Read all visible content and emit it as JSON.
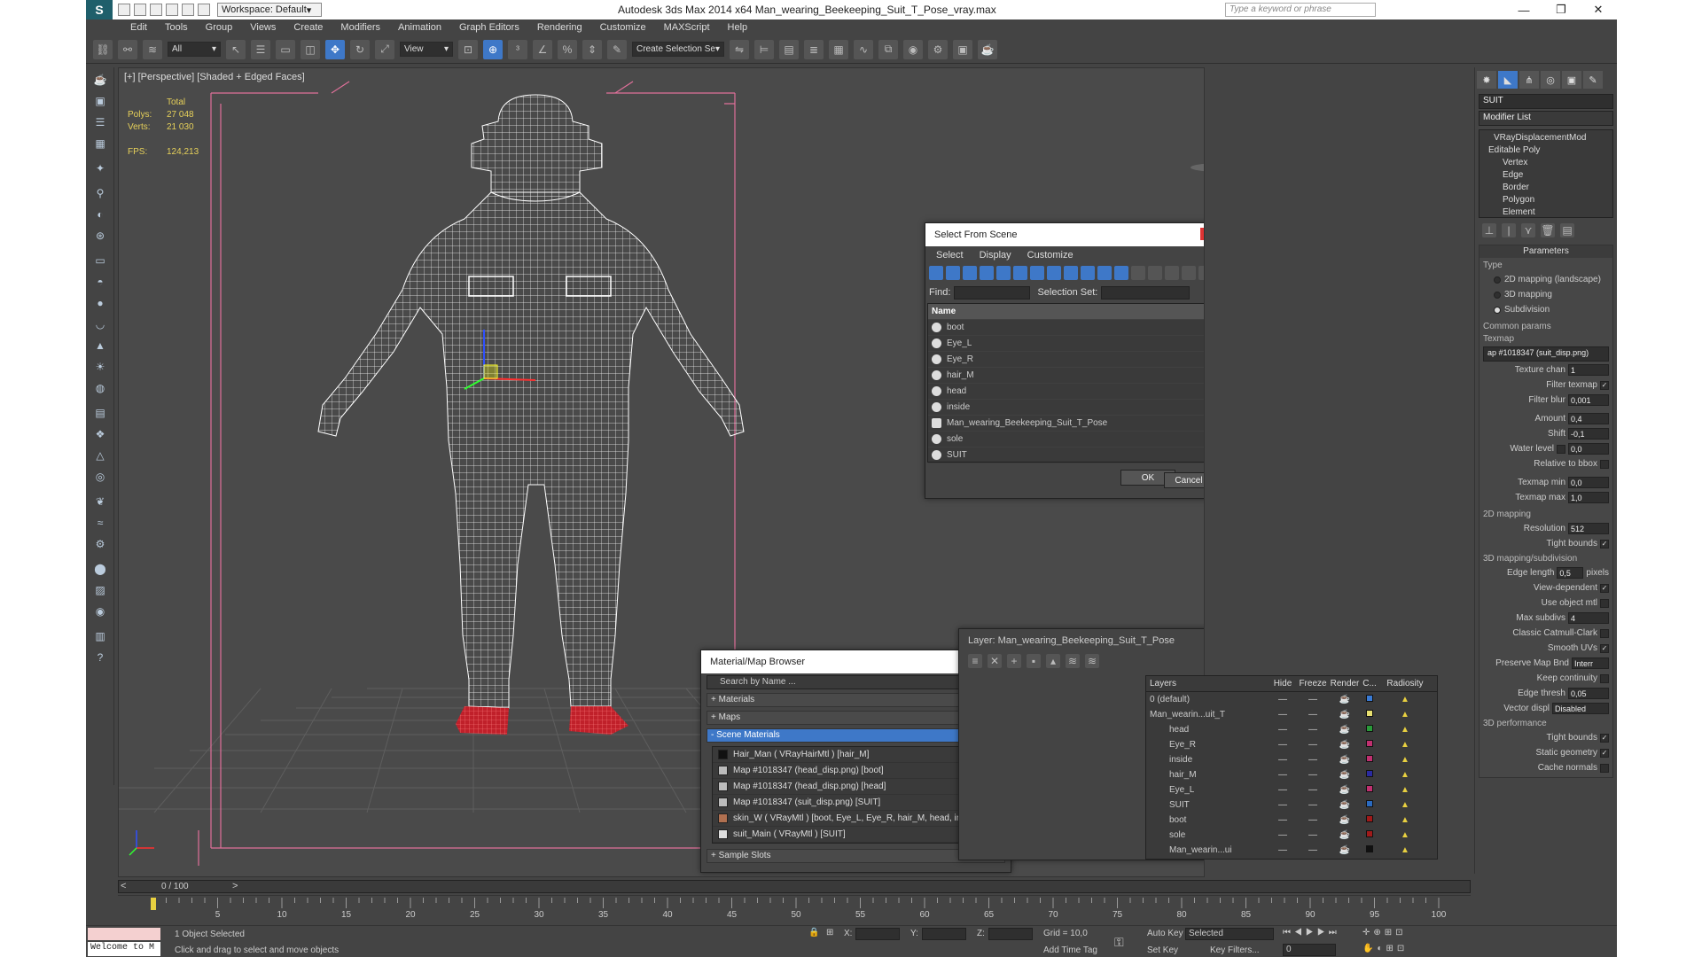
{
  "app": {
    "title": "Autodesk 3ds Max  2014 x64    Man_wearing_Beekeeping_Suit_T_Pose_vray.max",
    "workspace": "Workspace: Default",
    "search_placeholder": "Type a keyword or phrase"
  },
  "menu": [
    "Edit",
    "Tools",
    "Group",
    "Views",
    "Create",
    "Modifiers",
    "Animation",
    "Graph Editors",
    "Rendering",
    "Customize",
    "MAXScript",
    "Help"
  ],
  "toolbar": {
    "filter": "All",
    "ref_coord": "View",
    "selection_set": "Create Selection Se"
  },
  "viewport": {
    "label": "[+] [Perspective] [Shaded + Edged Faces]",
    "stats": {
      "total_label": "Total",
      "polys_label": "Polys:",
      "polys_value": "27 048",
      "verts_label": "Verts:",
      "verts_value": "21 030",
      "fps_label": "FPS:",
      "fps_value": "124,213"
    }
  },
  "command_panel": {
    "object_name": "SUIT",
    "modifier_list": "Modifier List",
    "stack": [
      "VRayDisplacementMod",
      "Editable Poly",
      "Vertex",
      "Edge",
      "Border",
      "Polygon",
      "Element"
    ],
    "parameters_title": "Parameters",
    "type_label": "Type",
    "type_options": [
      "2D mapping (landscape)",
      "3D mapping",
      "Subdivision"
    ],
    "common_params": "Common params",
    "texmap_label": "Texmap",
    "texmap_value": "ap #1018347 (suit_disp.png)",
    "texture_chan_label": "Texture chan",
    "texture_chan_value": "1",
    "filter_texmap_label": "Filter texmap",
    "filter_blur_label": "Filter blur",
    "filter_blur_value": "0,001",
    "amount_label": "Amount",
    "amount_value": "0,4",
    "shift_label": "Shift",
    "shift_value": "-0,1",
    "water_level_label": "Water level",
    "water_level_value": "0,0",
    "relative_bbox_label": "Relative to bbox",
    "texmap_min_label": "Texmap min",
    "texmap_min_value": "0,0",
    "texmap_max_label": "Texmap max",
    "texmap_max_value": "1,0",
    "mapping2d_title": "2D mapping",
    "resolution_label": "Resolution",
    "resolution_value": "512",
    "tight_bounds_label": "Tight bounds",
    "mapping3d_title": "3D mapping/subdivision",
    "edge_length_label": "Edge length",
    "edge_length_value": "0,5",
    "pixels_label": "pixels",
    "view_dependent_label": "View-dependent",
    "use_object_mtl_label": "Use object mtl",
    "max_subdivs_label": "Max subdivs",
    "max_subdivs_value": "4",
    "classic_catmull_label": "Classic Catmull-Clark",
    "smooth_uvs_label": "Smooth UVs",
    "preserve_map_label": "Preserve Map Bnd",
    "preserve_map_value": "Interr",
    "keep_continuity_label": "Keep continuity",
    "edge_thresh_label": "Edge thresh",
    "edge_thresh_value": "0,05",
    "vector_displ_label": "Vector displ",
    "vector_displ_value": "Disabled",
    "perf_title": "3D performance",
    "perf_tight_bounds_label": "Tight bounds",
    "static_geometry_label": "Static geometry",
    "cache_normals_label": "Cache normals"
  },
  "select_dialog": {
    "title": "Select From Scene",
    "menu": [
      "Select",
      "Display",
      "Customize"
    ],
    "find_label": "Find:",
    "selection_set_label": "Selection Set:",
    "column_name": "Name",
    "items": [
      "boot",
      "Eye_L",
      "Eye_R",
      "hair_M",
      "head",
      "inside",
      "Man_wearing_Beekeeping_Suit_T_Pose",
      "sole",
      "SUIT"
    ],
    "ok": "OK",
    "cancel": "Cancel"
  },
  "material_browser": {
    "title": "Material/Map Browser",
    "search_placeholder": "Search by Name ...",
    "sections": [
      "+ Materials",
      "+ Maps",
      "- Scene Materials"
    ],
    "scene_materials": [
      {
        "name": "Hair_Man  ( VRayHairMtl ) [hair_M]",
        "color": "#111111"
      },
      {
        "name": "Map #1018347 (head_disp.png) [boot]",
        "color": "#bbbbbb"
      },
      {
        "name": "Map #1018347 (head_disp.png) [head]",
        "color": "#bbbbbb"
      },
      {
        "name": "Map #1018347 (suit_disp.png) [SUIT]",
        "color": "#bbbbbb"
      },
      {
        "name": "skin_W  ( VRayMtl ) [boot, Eye_L, Eye_R, hair_M, head, inside,...",
        "color": "#b07050"
      },
      {
        "name": "suit_Main  ( VRayMtl ) [SUIT]",
        "color": "#dddddd"
      }
    ],
    "sample_slots": "+ Sample Slots"
  },
  "layer_dialog": {
    "title": "Layer: Man_wearing_Beekeeping_Suit_T_Pose",
    "columns": [
      "Layers",
      "Hide",
      "Freeze",
      "Render",
      "C...",
      "Radiosity"
    ],
    "rows": [
      {
        "name": "0 (default)",
        "color": "#3a7bd5"
      },
      {
        "name": "Man_wearin...uit_T",
        "color": "#e8e070"
      },
      {
        "name": "head",
        "color": "#2a9a3a"
      },
      {
        "name": "Eye_R",
        "color": "#c03070"
      },
      {
        "name": "inside",
        "color": "#c03070"
      },
      {
        "name": "hair_M",
        "color": "#2a2aa0"
      },
      {
        "name": "Eye_L",
        "color": "#c03070"
      },
      {
        "name": "SUIT",
        "color": "#2a6ac0"
      },
      {
        "name": "boot",
        "color": "#a01a1a"
      },
      {
        "name": "sole",
        "color": "#a01a1a"
      },
      {
        "name": "Man_wearin...ui",
        "color": "#111111"
      }
    ]
  },
  "timeline": {
    "frame": "0 / 100",
    "ticks": [
      "5",
      "10",
      "15",
      "20",
      "25",
      "30",
      "35",
      "40",
      "45",
      "50",
      "55",
      "60",
      "65",
      "70",
      "75",
      "80",
      "85",
      "90",
      "95",
      "100"
    ]
  },
  "status": {
    "welcome": "Welcome to M",
    "selected": "1 Object Selected",
    "prompt": "Click and drag to select and move objects",
    "x_label": "X:",
    "y_label": "Y:",
    "z_label": "Z:",
    "grid": "Grid = 10,0",
    "auto_key": "Auto Key",
    "set_key": "Set Key",
    "selected_dd": "Selected",
    "key_filters": "Key Filters...",
    "add_time_tag": "Add Time Tag",
    "frame_field": "0"
  }
}
